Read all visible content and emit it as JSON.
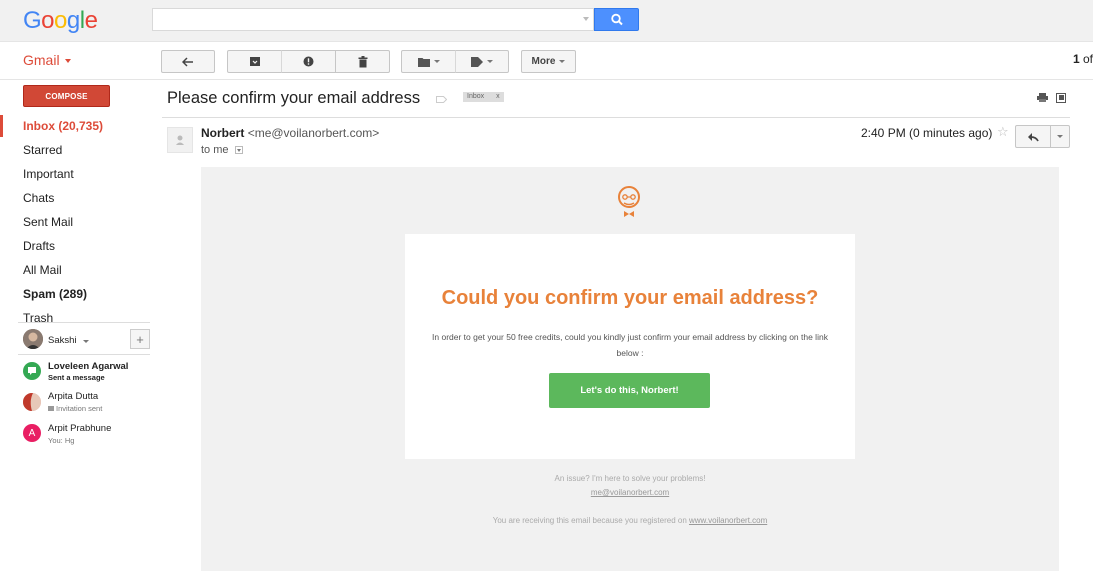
{
  "brand": {
    "logo_letters": [
      {
        "char": "G",
        "color": "#4285f4"
      },
      {
        "char": "o",
        "color": "#ea4335"
      },
      {
        "char": "o",
        "color": "#fbbc05"
      },
      {
        "char": "g",
        "color": "#4285f4"
      },
      {
        "char": "l",
        "color": "#34a853"
      },
      {
        "char": "e",
        "color": "#ea4335"
      }
    ]
  },
  "search": {
    "value": "",
    "placeholder": "",
    "button_icon": "search-icon"
  },
  "toolbar": {
    "app_label": "Gmail",
    "back_icon": "back-arrow-icon",
    "archive_icon": "archive-icon",
    "spam_icon": "report-spam-icon",
    "delete_icon": "trash-icon",
    "move_icon": "folder-icon",
    "labels_icon": "label-tag-icon",
    "more_label": "More",
    "pager": {
      "current": "1",
      "suffix": "of"
    }
  },
  "sidebar": {
    "compose_label": "COMPOSE",
    "items": [
      {
        "label": "Inbox (20,735)",
        "state": "active"
      },
      {
        "label": "Starred",
        "state": "normal"
      },
      {
        "label": "Important",
        "state": "normal"
      },
      {
        "label": "Chats",
        "state": "normal"
      },
      {
        "label": "Sent Mail",
        "state": "normal"
      },
      {
        "label": "Drafts",
        "state": "normal"
      },
      {
        "label": "All Mail",
        "state": "normal"
      },
      {
        "label": "Spam (289)",
        "state": "bold"
      },
      {
        "label": "Trash",
        "state": "normal"
      }
    ]
  },
  "hangouts": {
    "me": {
      "name": "Sakshi"
    },
    "add_label": "+",
    "contacts": [
      {
        "name": "Loveleen Agarwal",
        "status": "Sent a message",
        "avatar_color": "#34a853",
        "bold": true
      },
      {
        "name": "Arpita Dutta",
        "status": "Invitation sent",
        "avatar_color": "#c0392b",
        "bold": false
      },
      {
        "name": "Arpit Prabhune",
        "status": "You: Hg",
        "avatar_color": "#e91e63",
        "initial": "A",
        "bold": false
      }
    ]
  },
  "email": {
    "subject": "Please confirm your email address",
    "label_chip": "Inbox",
    "label_chip_close": "x",
    "sender_name": "Norbert",
    "sender_email": "<me@voilanorbert.com>",
    "to_line": "to me",
    "time": "2:40 PM (0 minutes ago)",
    "body": {
      "title": "Could you confirm your email address?",
      "text": "In order to get your 50 free credits, could you kindly just confirm your email address by clicking on the link below :",
      "cta_label": "Let's do this, Norbert!",
      "footer_issue": "An issue? I'm here to solve your problems!",
      "footer_email": "me@voilanorbert.com",
      "footer_note_prefix": "You are receiving this email because you registered on ",
      "footer_note_link": "www.voilanorbert.com"
    }
  }
}
